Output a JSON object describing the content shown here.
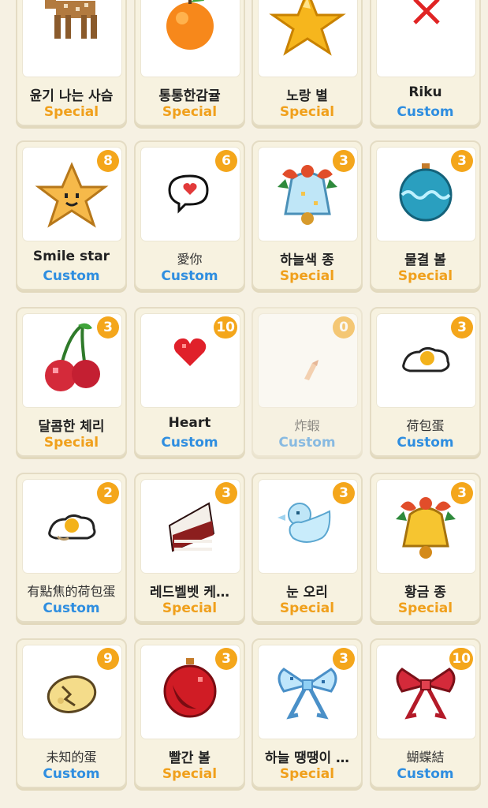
{
  "colors": {
    "special": "#f0a01c",
    "custom": "#2f8ee0",
    "badge": "#f4a61b",
    "background": "#f6f1e3"
  },
  "cards": [
    {
      "title": "윤기 나는 사슴",
      "type": "Special",
      "count": "",
      "icon": "deer-icon"
    },
    {
      "title": "통통한감귤",
      "type": "Special",
      "count": "",
      "icon": "orange-icon"
    },
    {
      "title": "노랑 별",
      "type": "Special",
      "count": "",
      "icon": "star-icon"
    },
    {
      "title": "Riku",
      "type": "Custom",
      "count": "",
      "icon": "red-x-icon"
    },
    {
      "title": "Smile star",
      "type": "Custom",
      "count": "8",
      "icon": "smile-star-icon"
    },
    {
      "title": "愛你",
      "type": "Custom",
      "count": "6",
      "icon": "heart-speech-bubble-icon"
    },
    {
      "title": "하늘색 종",
      "type": "Special",
      "count": "3",
      "icon": "sky-blue-bell-icon"
    },
    {
      "title": "물결 볼",
      "type": "Special",
      "count": "3",
      "icon": "wave-ornament-icon"
    },
    {
      "title": "달콤한 체리",
      "type": "Special",
      "count": "3",
      "icon": "cherry-icon"
    },
    {
      "title": "Heart",
      "type": "Custom",
      "count": "10",
      "icon": "heart-icon"
    },
    {
      "title": "炸蝦",
      "type": "Custom",
      "count": "0",
      "icon": "fried-shrimp-icon"
    },
    {
      "title": "荷包蛋",
      "type": "Custom",
      "count": "3",
      "icon": "fried-egg-icon"
    },
    {
      "title": "有點焦的荷包蛋",
      "type": "Custom",
      "count": "2",
      "icon": "burnt-fried-egg-icon"
    },
    {
      "title": "레드벨벳 케…",
      "type": "Special",
      "count": "3",
      "icon": "red-velvet-cake-icon"
    },
    {
      "title": "눈 오리",
      "type": "Special",
      "count": "3",
      "icon": "snow-duck-icon"
    },
    {
      "title": "황금 종",
      "type": "Special",
      "count": "3",
      "icon": "golden-bell-icon"
    },
    {
      "title": "未知的蛋",
      "type": "Custom",
      "count": "9",
      "icon": "unknown-egg-icon"
    },
    {
      "title": "빨간 볼",
      "type": "Special",
      "count": "3",
      "icon": "red-ornament-icon"
    },
    {
      "title": "하늘 땡땡이 …",
      "type": "Special",
      "count": "3",
      "icon": "blue-polka-bow-icon"
    },
    {
      "title": "蝴蝶結",
      "type": "Custom",
      "count": "10",
      "icon": "red-bow-icon"
    }
  ]
}
